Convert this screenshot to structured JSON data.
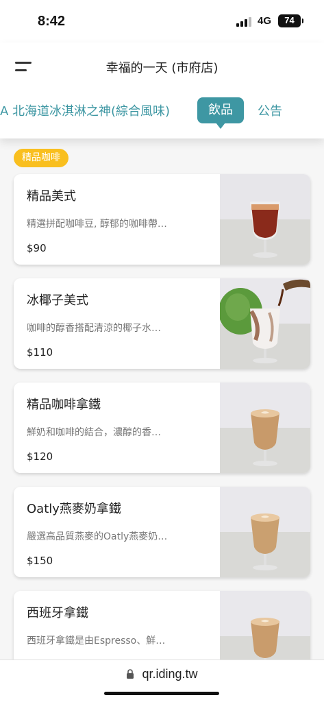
{
  "status": {
    "time": "8:42",
    "network": "4G",
    "battery": "74"
  },
  "header": {
    "store_title": "幸福的一天 (市府店)"
  },
  "tabs": [
    {
      "label": "A 北海道冰淇淋之神(綜合風味)",
      "active": false
    },
    {
      "label": "飲品",
      "active": true
    },
    {
      "label": "公告",
      "active": false
    }
  ],
  "category": {
    "label": "精品咖啡"
  },
  "items": [
    {
      "name": "精品美式",
      "desc": "精選拼配咖啡豆, 醇郁的咖啡帶…",
      "price": "$90",
      "image": "americano-glass"
    },
    {
      "name": "冰椰子美式",
      "desc": "咖啡的醇香搭配清涼的椰子水…",
      "price": "$110",
      "image": "coconut-americano-glass"
    },
    {
      "name": "精品咖啡拿鐵",
      "desc": "鮮奶和咖啡的結合，濃醇的香…",
      "price": "$120",
      "image": "latte-glass"
    },
    {
      "name": "Oatly燕麥奶拿鐵",
      "desc": "嚴選高品質燕麥的Oatly燕麥奶…",
      "price": "$150",
      "image": "latte-glass"
    },
    {
      "name": "西班牙拿鐵",
      "desc": "西班牙拿鐵是由Espresso、鮮…",
      "price": "",
      "image": "latte-glass"
    }
  ],
  "browser": {
    "url": "qr.iding.tw"
  },
  "colors": {
    "accent": "#3e97a3",
    "badge": "#f9bf1f"
  }
}
